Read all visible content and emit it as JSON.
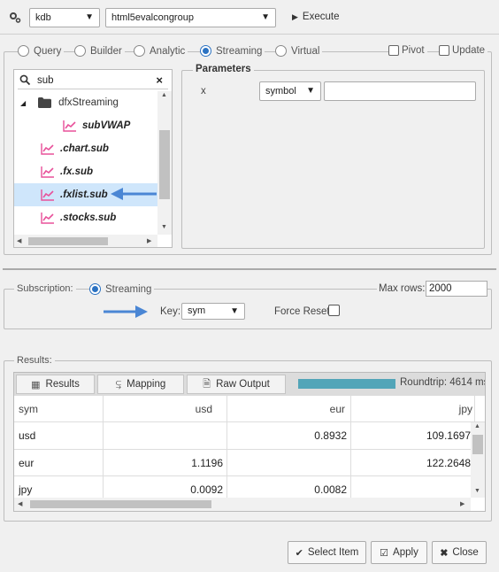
{
  "toolbar": {
    "server": "kdb",
    "group": "html5evalcongroup",
    "execute_label": "Execute"
  },
  "modes": {
    "query": "Query",
    "builder": "Builder",
    "analytic": "Analytic",
    "streaming": "Streaming",
    "virtual": "Virtual",
    "pivot": "Pivot",
    "update": "Update"
  },
  "tree": {
    "search_value": "sub",
    "items": [
      {
        "label": "dfxStreaming"
      },
      {
        "label": "subVWAP"
      },
      {
        "label": ".chart.sub"
      },
      {
        "label": ".fx.sub"
      },
      {
        "label": ".fxlist.sub"
      },
      {
        "label": ".stocks.sub"
      }
    ]
  },
  "parameters": {
    "title": "Parameters",
    "param_name": "x",
    "type_value": "symbol",
    "value": ""
  },
  "subscription": {
    "label": "Subscription:",
    "streaming_label": "Streaming",
    "max_rows_label": "Max rows:",
    "max_rows_value": "2000",
    "key_label": "Key:",
    "key_value": "sym",
    "force_reset_label": "Force Reset:"
  },
  "results": {
    "label": "Results:",
    "tabs": {
      "results": "Results",
      "mapping": "Mapping",
      "raw_output": "Raw Output"
    },
    "roundtrip": "Roundtrip: 4614 ms",
    "columns": [
      "sym",
      "usd",
      "eur",
      "jpy"
    ],
    "rows": [
      [
        "usd",
        "",
        "0.8932",
        "109.1697"
      ],
      [
        "eur",
        "1.1196",
        "",
        "122.2648"
      ],
      [
        "jpy",
        "0.0092",
        "0.0082",
        ""
      ]
    ]
  },
  "footer": {
    "select_item": "Select Item",
    "apply": "Apply",
    "close": "Close"
  }
}
